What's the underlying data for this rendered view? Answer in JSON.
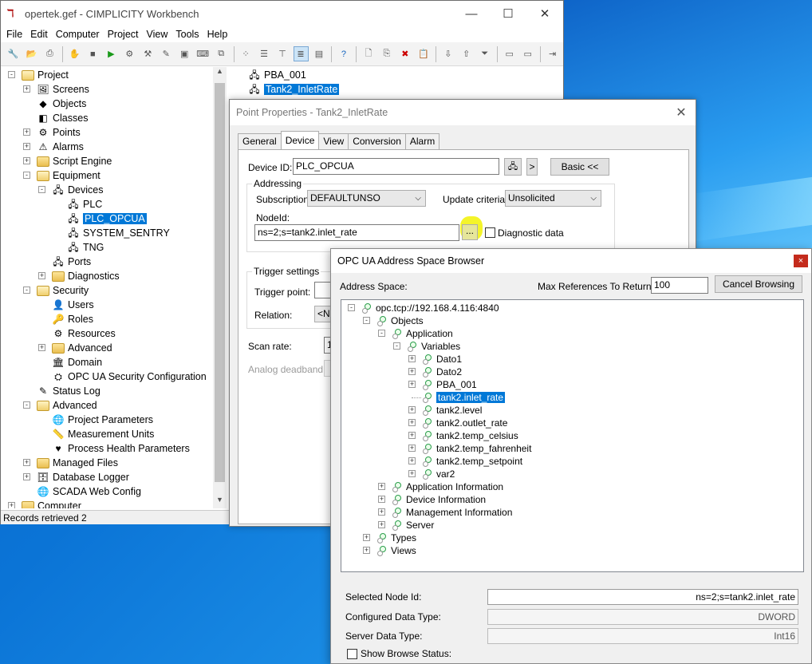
{
  "workbench": {
    "title": "opertek.gef - CIMPLICITY Workbench",
    "menu": [
      "File",
      "Edit",
      "Computer",
      "Project",
      "View",
      "Tools",
      "Help"
    ],
    "tree": [
      {
        "label": "Project",
        "level": 0,
        "type": "folder-open",
        "exp": "-"
      },
      {
        "label": "Screens",
        "level": 1,
        "type": "screens",
        "exp": "+"
      },
      {
        "label": "Objects",
        "level": 1,
        "type": "objects",
        "exp": ""
      },
      {
        "label": "Classes",
        "level": 1,
        "type": "classes",
        "exp": ""
      },
      {
        "label": "Points",
        "level": 1,
        "type": "points",
        "exp": "+"
      },
      {
        "label": "Alarms",
        "level": 1,
        "type": "alarms",
        "exp": "+"
      },
      {
        "label": "Script Engine",
        "level": 1,
        "type": "folder",
        "exp": "+"
      },
      {
        "label": "Equipment",
        "level": 1,
        "type": "folder-open",
        "exp": "-"
      },
      {
        "label": "Devices",
        "level": 2,
        "type": "devices",
        "exp": "-"
      },
      {
        "label": "PLC",
        "level": 3,
        "type": "device",
        "exp": ""
      },
      {
        "label": "PLC_OPCUA",
        "level": 3,
        "type": "device",
        "exp": "",
        "selected": true
      },
      {
        "label": "SYSTEM_SENTRY",
        "level": 3,
        "type": "device",
        "exp": ""
      },
      {
        "label": "TNG",
        "level": 3,
        "type": "device",
        "exp": ""
      },
      {
        "label": "Ports",
        "level": 2,
        "type": "ports",
        "exp": ""
      },
      {
        "label": "Diagnostics",
        "level": 2,
        "type": "folder",
        "exp": "+"
      },
      {
        "label": "Security",
        "level": 1,
        "type": "folder-open",
        "exp": "-"
      },
      {
        "label": "Users",
        "level": 2,
        "type": "users",
        "exp": ""
      },
      {
        "label": "Roles",
        "level": 2,
        "type": "roles",
        "exp": ""
      },
      {
        "label": "Resources",
        "level": 2,
        "type": "resources",
        "exp": ""
      },
      {
        "label": "Advanced",
        "level": 2,
        "type": "folder",
        "exp": "+"
      },
      {
        "label": "Domain",
        "level": 2,
        "type": "domain",
        "exp": ""
      },
      {
        "label": "OPC UA Security Configuration",
        "level": 2,
        "type": "opcua",
        "exp": ""
      },
      {
        "label": "Status Log",
        "level": 1,
        "type": "statuslog",
        "exp": ""
      },
      {
        "label": "Advanced",
        "level": 1,
        "type": "folder-open",
        "exp": "-"
      },
      {
        "label": "Project Parameters",
        "level": 2,
        "type": "globe",
        "exp": ""
      },
      {
        "label": "Measurement Units",
        "level": 2,
        "type": "units",
        "exp": ""
      },
      {
        "label": "Process Health Parameters",
        "level": 2,
        "type": "health",
        "exp": ""
      },
      {
        "label": "Managed Files",
        "level": 1,
        "type": "folder",
        "exp": "+"
      },
      {
        "label": "Database Logger",
        "level": 1,
        "type": "dblogger",
        "exp": "+"
      },
      {
        "label": "SCADA Web Config",
        "level": 1,
        "type": "web",
        "exp": ""
      },
      {
        "label": "Computer",
        "level": 0,
        "type": "folder",
        "exp": "+"
      }
    ],
    "list": [
      {
        "label": "PBA_001",
        "selected": false
      },
      {
        "label": "Tank2_InletRate",
        "selected": true
      }
    ],
    "status": "Records retrieved  2"
  },
  "point_properties": {
    "title": "Point Properties - Tank2_InletRate",
    "tabs": [
      "General",
      "Device",
      "View",
      "Conversion",
      "Alarm"
    ],
    "active_tab": "Device",
    "device_id_label": "Device ID:",
    "device_id": "PLC_OPCUA",
    "next_btn": ">",
    "basic_btn": "Basic <<",
    "addressing_label": "Addressing",
    "subscription_label": "Subscription:",
    "subscription": "DEFAULTUNSO",
    "update_criteria_label": "Update criteria:",
    "update_criteria": "Unsolicited",
    "nodeid_label": "NodeId:",
    "nodeid": "ns=2;s=tank2.inlet_rate",
    "browse_btn": "...",
    "diagnostic_label": "Diagnostic data",
    "trigger_settings_label": "Trigger settings",
    "trigger_point_label": "Trigger point:",
    "relation_label": "Relation:",
    "relation_value": "<No",
    "scan_rate_label": "Scan rate:",
    "scan_rate_value": "1",
    "analog_deadband_label": "Analog deadband:"
  },
  "opc_browser": {
    "title": "OPC UA Address Space Browser",
    "close": "×",
    "address_space_label": "Address Space:",
    "max_refs_label": "Max References To Return:",
    "max_refs": "100",
    "cancel_btn": "Cancel Browsing",
    "nodes": [
      {
        "label": "opc.tcp://192.168.4.116:4840",
        "level": 0,
        "exp": "-"
      },
      {
        "label": "Objects",
        "level": 1,
        "exp": "-"
      },
      {
        "label": "Application",
        "level": 2,
        "exp": "-"
      },
      {
        "label": "Variables",
        "level": 3,
        "exp": "-"
      },
      {
        "label": "Dato1",
        "level": 4,
        "exp": "+"
      },
      {
        "label": "Dato2",
        "level": 4,
        "exp": "+"
      },
      {
        "label": "PBA_001",
        "level": 4,
        "exp": "+"
      },
      {
        "label": "tank2.inlet_rate",
        "level": 4,
        "exp": "",
        "selected": true
      },
      {
        "label": "tank2.level",
        "level": 4,
        "exp": "+"
      },
      {
        "label": "tank2.outlet_rate",
        "level": 4,
        "exp": "+"
      },
      {
        "label": "tank2.temp_celsius",
        "level": 4,
        "exp": "+"
      },
      {
        "label": "tank2.temp_fahrenheit",
        "level": 4,
        "exp": "+"
      },
      {
        "label": "tank2.temp_setpoint",
        "level": 4,
        "exp": "+"
      },
      {
        "label": "var2",
        "level": 4,
        "exp": "+"
      },
      {
        "label": "Application Information",
        "level": 2,
        "exp": "+"
      },
      {
        "label": "Device Information",
        "level": 2,
        "exp": "+"
      },
      {
        "label": "Management Information",
        "level": 2,
        "exp": "+"
      },
      {
        "label": "Server",
        "level": 2,
        "exp": "+"
      },
      {
        "label": "Types",
        "level": 1,
        "exp": "+"
      },
      {
        "label": "Views",
        "level": 1,
        "exp": "+"
      }
    ],
    "selected_node_label": "Selected Node Id:",
    "selected_node": "ns=2;s=tank2.inlet_rate",
    "configured_type_label": "Configured Data Type:",
    "configured_type": "DWORD",
    "server_type_label": "Server Data Type:",
    "server_type": "Int16",
    "show_status_label": "Show Browse Status:"
  }
}
